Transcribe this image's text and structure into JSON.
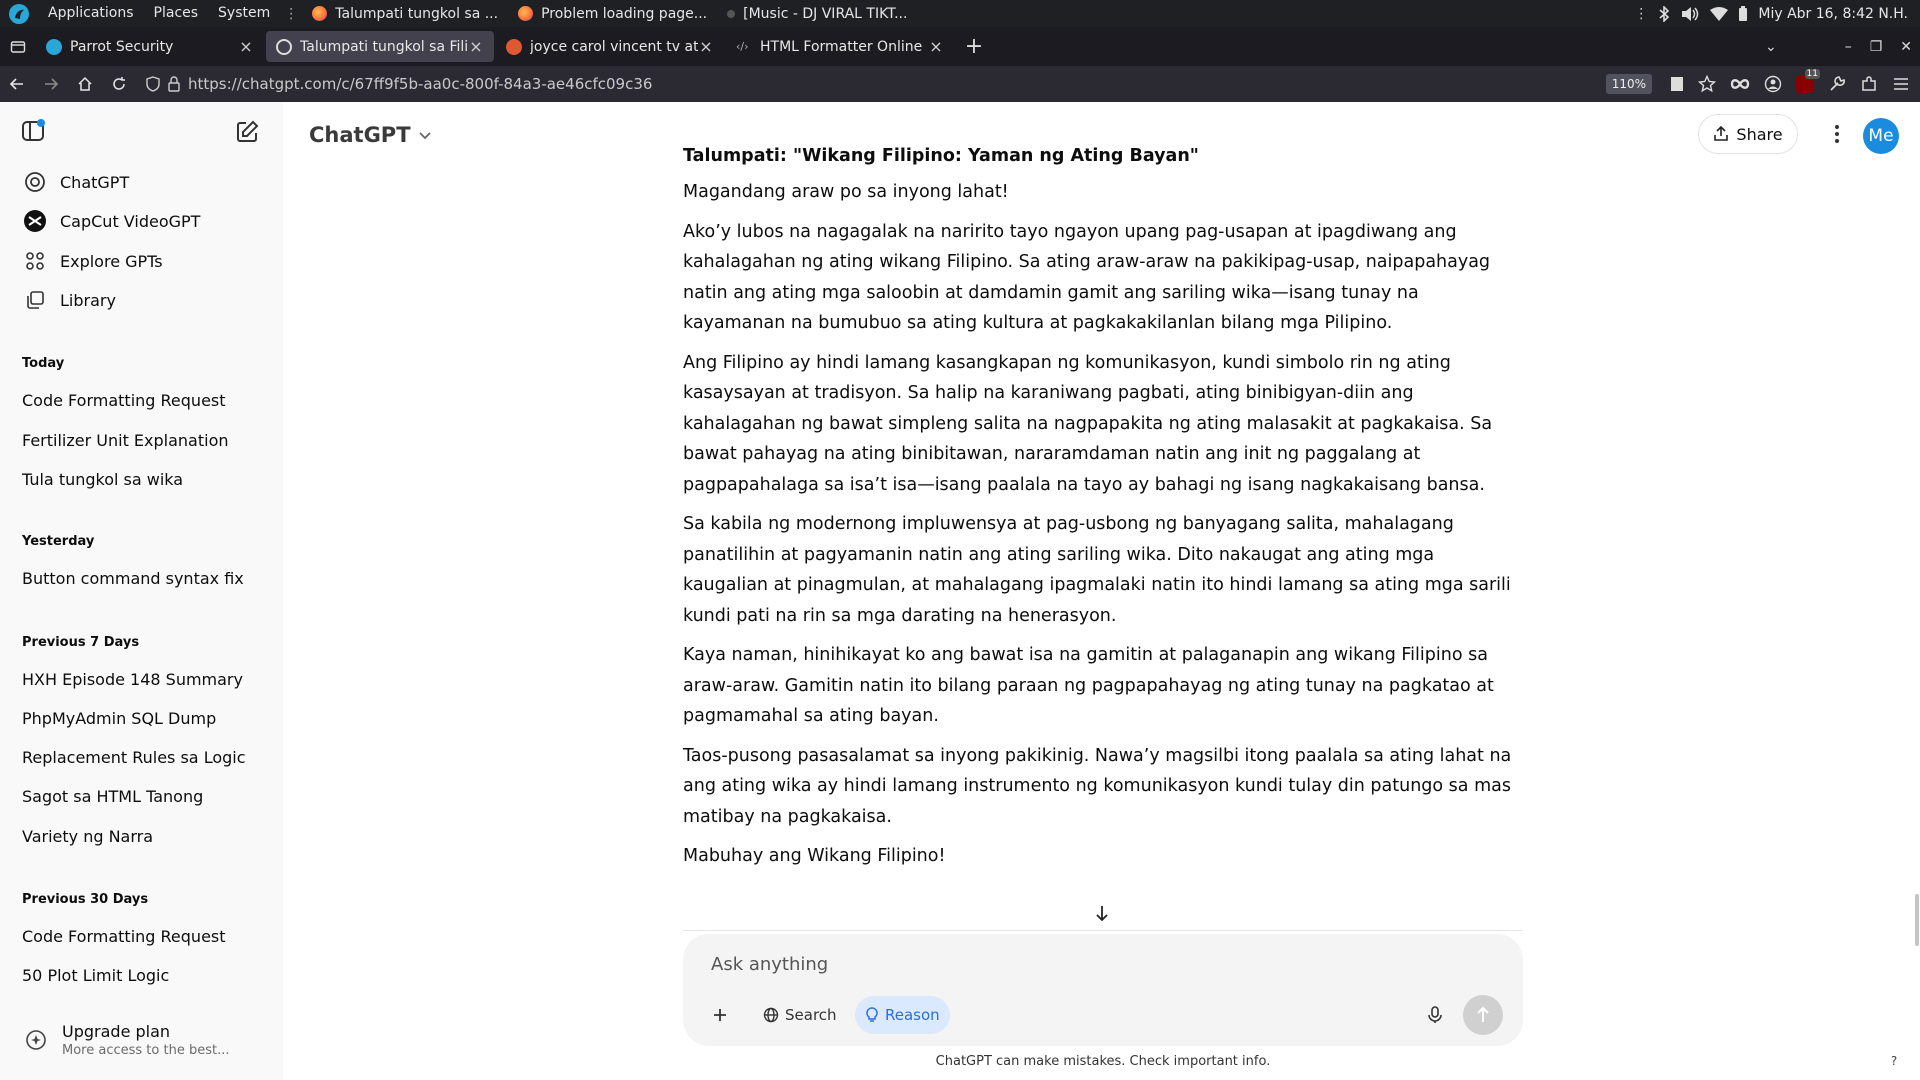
{
  "os": {
    "menus": [
      "Applications",
      "Places",
      "System"
    ],
    "tasks": [
      {
        "label": "Talumpati tungkol sa ...",
        "icon": "firefox-icon"
      },
      {
        "label": "Problem loading page...",
        "icon": "firefox-icon"
      },
      {
        "label": "[Music - DJ VIRAL TIKT...",
        "icon": "music-icon"
      }
    ],
    "clock": "Miy Abr 16,  8:42 N.H."
  },
  "browser": {
    "tabs": [
      {
        "title": "Parrot Security",
        "active": false
      },
      {
        "title": "Talumpati tungkol sa Filip",
        "active": true
      },
      {
        "title": "joyce carol vincent tv at D",
        "active": false
      },
      {
        "title": "HTML Formatter Online",
        "active": false
      }
    ],
    "url": "https://chatgpt.com/c/67ff9f5b-aa0c-800f-84a3-ae46cfc09c36",
    "zoom": "110%",
    "extension_badge": "11"
  },
  "sidebar": {
    "nav": [
      {
        "label": "ChatGPT",
        "icon": "openai-logo-icon"
      },
      {
        "label": "CapCut VideoGPT",
        "icon": "capcut-icon"
      },
      {
        "label": "Explore GPTs",
        "icon": "grid-icon"
      },
      {
        "label": "Library",
        "icon": "library-icon"
      }
    ],
    "sections": [
      {
        "heading": "Today",
        "items": [
          "Code Formatting Request",
          "Fertilizer Unit Explanation",
          "Tula tungkol sa wika"
        ]
      },
      {
        "heading": "Yesterday",
        "items": [
          "Button command syntax fix"
        ]
      },
      {
        "heading": "Previous 7 Days",
        "items": [
          "HXH Episode 148 Summary",
          "PhpMyAdmin SQL Dump",
          "Replacement Rules sa Logic",
          "Sagot sa HTML Tanong",
          "Variety ng Narra"
        ]
      },
      {
        "heading": "Previous 30 Days",
        "items": [
          "Code Formatting Request",
          "50 Plot Limit Logic"
        ]
      }
    ],
    "upgrade": {
      "title": "Upgrade plan",
      "subtitle": "More access to the best..."
    }
  },
  "main": {
    "model_label": "ChatGPT",
    "share_label": "Share",
    "avatar_initials": "Me",
    "article": {
      "title": "Talumpati: \"Wikang Filipino: Yaman ng Ating Bayan\"",
      "paragraphs": [
        "Magandang araw po sa inyong lahat!",
        "Ako’y lubos na nagagalak na naririto tayo ngayon upang pag-usapan at ipagdiwang ang kahalagahan ng ating wikang Filipino. Sa ating araw-araw na pakikipag-usap, naipapahayag natin ang ating mga saloobin at damdamin gamit ang sariling wika—isang tunay na kayamanan na bumubuo sa ating kultura at pagkakakilanlan bilang mga Pilipino.",
        "Ang Filipino ay hindi lamang kasangkapan ng komunikasyon, kundi simbolo rin ng ating kasaysayan at tradisyon. Sa halip na karaniwang pagbati, ating binibigyan-diin ang kahalagahan ng bawat simpleng salita na nagpapakita ng ating malasakit at pagkakaisa. Sa bawat pahayag na ating binibitawan, nararamdaman natin ang init ng paggalang at pagpapahalaga sa isa’t isa—isang paalala na tayo ay bahagi ng isang nagkakaisang bansa.",
        "Sa kabila ng modernong impluwensya at pag-usbong ng banyagang salita, mahalagang panatilihin at pagyamanin natin ang ating sariling wika. Dito nakaugat ang ating mga kaugalian at pinagmulan, at mahalagang ipagmalaki natin ito hindi lamang sa ating mga sarili kundi pati na rin sa mga darating na henerasyon.",
        "Kaya naman, hinihikayat ko ang bawat isa na gamitin at palaganapin ang wikang Filipino sa araw-araw. Gamitin natin ito bilang paraan ng pagpapahayag ng ating tunay na pagkatao at pagmamahal sa ating bayan.",
        "Taos-pusong pasasalamat sa inyong pakikinig. Nawa’y magsilbi itong paalala sa ating lahat na ang ating wika ay hindi lamang instrumento ng komunikasyon kundi tulay din patungo sa mas matibay na pagkakaisa.",
        "Mabuhay ang Wikang Filipino!"
      ]
    },
    "composer": {
      "placeholder": "Ask anything",
      "search_label": "Search",
      "reason_label": "Reason"
    },
    "disclaimer": "ChatGPT can make mistakes. Check important info.",
    "help_label": "?"
  },
  "colors": {
    "accent": "#1b8be0",
    "reason_bg": "#dbe9ff",
    "reason_fg": "#2a6fd6"
  }
}
